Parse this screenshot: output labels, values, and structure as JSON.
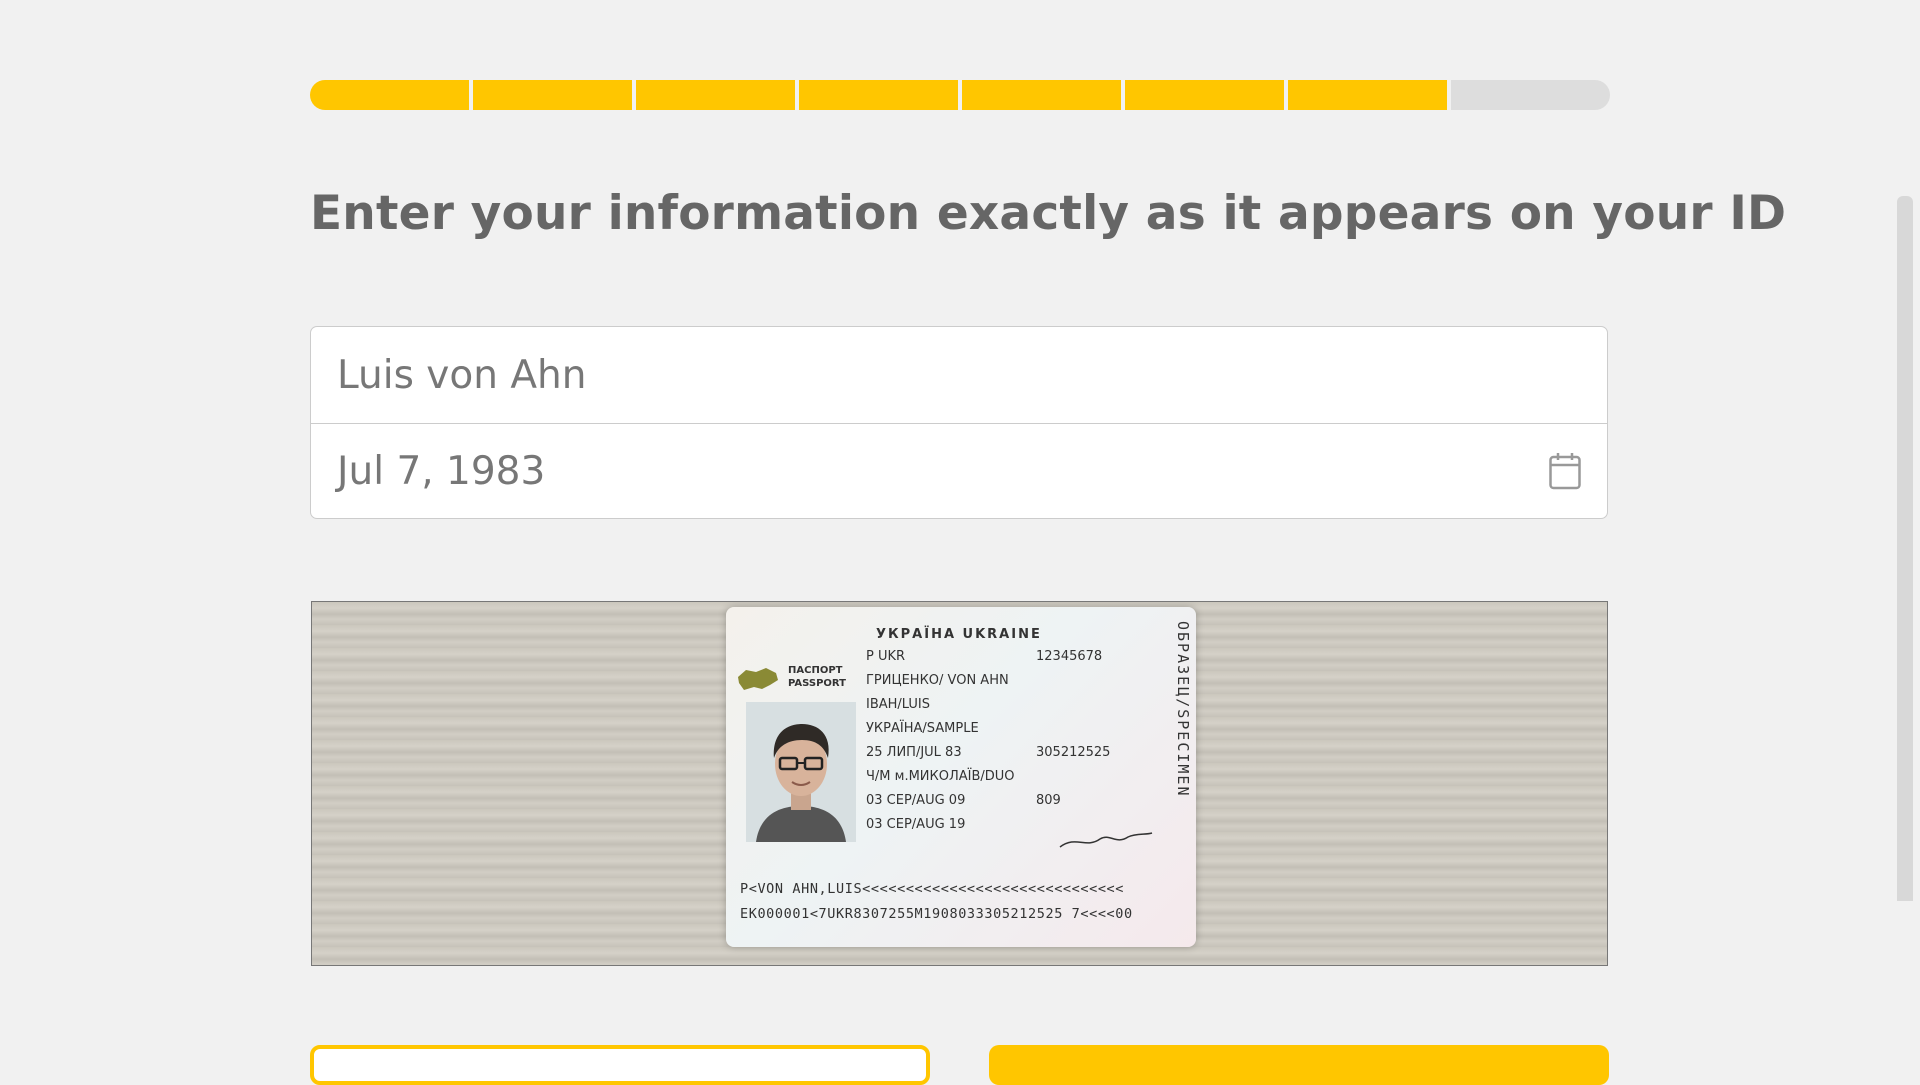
{
  "progress": {
    "total_steps": 8,
    "completed_steps": 7
  },
  "heading": "Enter your information exactly as it appears on your ID",
  "form": {
    "name_value": "Luis von Ahn",
    "dob_value": "Jul 7, 1983",
    "dob_icon": "calendar-icon"
  },
  "id_photo": {
    "country_header": "УКРАЇНА  UKRAINE",
    "passport_word": "ПАСПОРТ\nPASSPORT",
    "fields_left": [
      "P      UKR",
      "ГРИЦЕНКО/ VON AHN",
      "ІВАН/LUIS",
      "УКРАЇНА/SAMPLE",
      "25 ЛИП/JUL 83",
      "Ч/М     м.МИКОЛАЇВ/DUO",
      "03 СЕР/AUG 09",
      "03 СЕР/AUG 19"
    ],
    "fields_right": [
      "12345678",
      "",
      "",
      "",
      "305212525",
      "",
      "809"
    ],
    "specimen": "ОБРАЗЕЦ/SPECIMEN",
    "mrz_line1": "P<VON AHN,LUIS<<<<<<<<<<<<<<<<<<<<<<<<<<<<<<",
    "mrz_line2": "EK000001<7UKR8307255M1908033305212525 7<<<<00"
  },
  "colors": {
    "accent": "#ffc600",
    "progress_empty": "#dddddd",
    "heading": "#666666"
  }
}
